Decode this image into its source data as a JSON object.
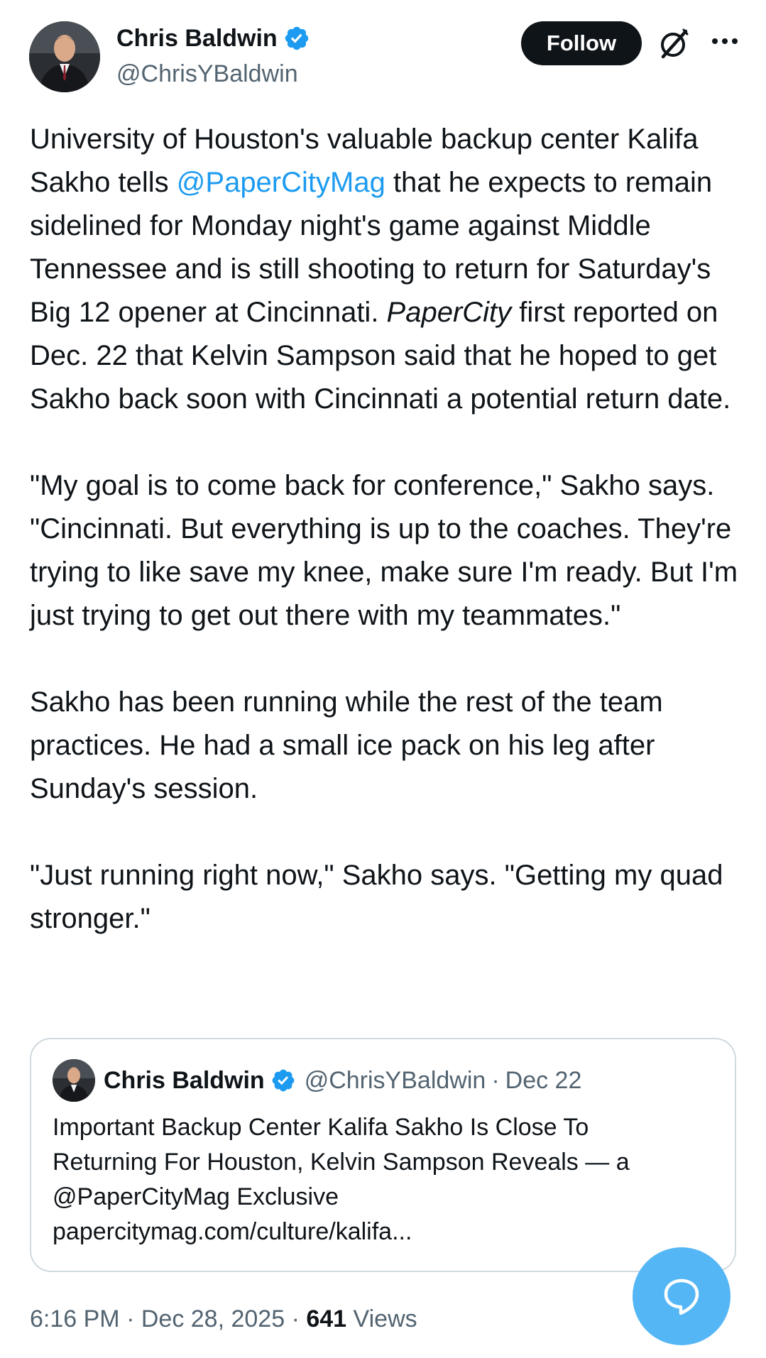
{
  "author": {
    "name": "Chris Baldwin",
    "handle": "@ChrisYBaldwin",
    "verified": true
  },
  "actions": {
    "follow_label": "Follow",
    "grok_icon": "grok-icon",
    "more_icon": "more-icon"
  },
  "tweet": {
    "p1": {
      "before_mention": "University of Houston's valuable backup center Kalifa Sakho tells ",
      "mention": "@PaperCityMag",
      "after_mention": " that he expects to remain sidelined for Monday night's game against Middle Tennessee and is still shooting to return for Saturday's Big 12 opener at Cincinnati. ",
      "italic": "PaperCity",
      "after_italic": " first reported on Dec. 22 that Kelvin Sampson said that he hoped to get Sakho back soon with Cincinnati a potential return date."
    },
    "p2": "\"My goal is to come back for conference,\" Sakho says. \"Cincinnati. But everything is up to the coaches. They're trying to like save my knee, make sure I'm ready. But I'm just trying to get out there with my teammates.\"",
    "p3": "Sakho has been running while the rest of the team practices. He had a small ice pack on his leg after Sunday's session.",
    "p4": "\"Just running right now,\" Sakho says. \"Getting my quad stronger.\""
  },
  "quote": {
    "name": "Chris Baldwin",
    "handle": "@ChrisYBaldwin",
    "separator": "·",
    "date": "Dec 22",
    "lines": [
      "Important Backup Center Kalifa Sakho Is Close To",
      "Returning For Houston, Kelvin Sampson Reveals — a",
      "@PaperCityMag Exclusive",
      "papercitymag.com/culture/kalifa..."
    ]
  },
  "meta": {
    "time": "6:16 PM",
    "separator": "·",
    "date": "Dec 28, 2025",
    "views_count": "641",
    "views_label": "Views"
  },
  "colors": {
    "accent": "#1d9bf0",
    "secondary_text": "#536471",
    "fab": "#55b6f5"
  }
}
